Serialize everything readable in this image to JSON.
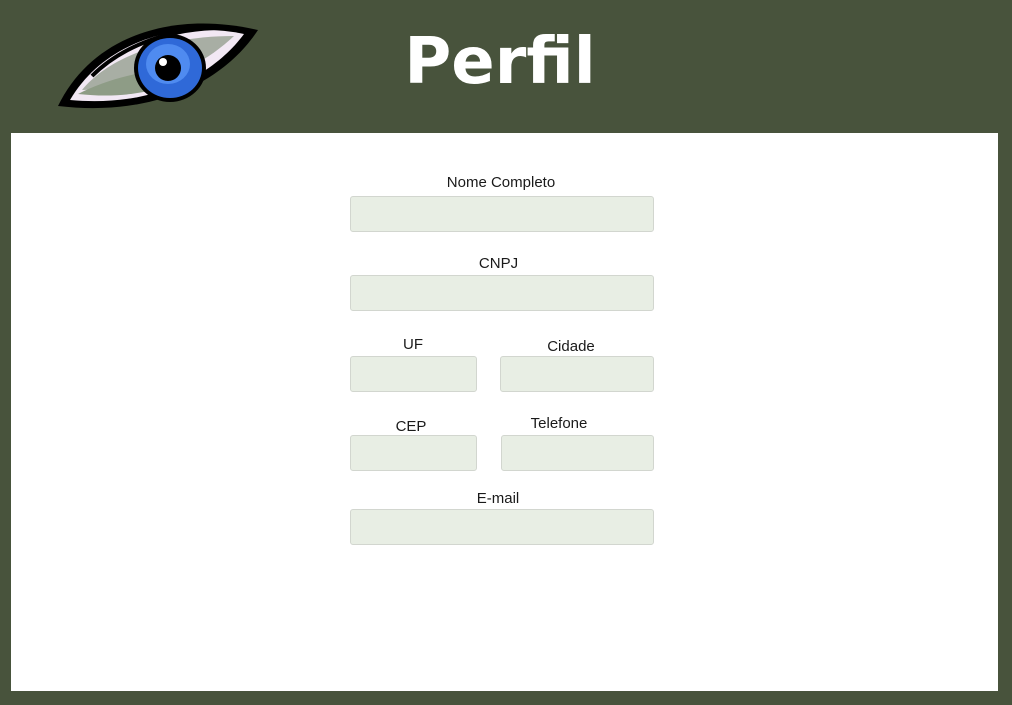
{
  "header": {
    "title": "Perfil",
    "logo_icon": "eye-icon"
  },
  "form": {
    "nome_completo": {
      "label": "Nome Completo",
      "value": ""
    },
    "cnpj": {
      "label": "CNPJ",
      "value": ""
    },
    "uf": {
      "label": "UF",
      "value": ""
    },
    "cidade": {
      "label": "Cidade",
      "value": ""
    },
    "cep": {
      "label": "CEP",
      "value": ""
    },
    "telefone": {
      "label": "Telefone",
      "value": ""
    },
    "email": {
      "label": "E-mail",
      "value": ""
    }
  },
  "colors": {
    "background": "#48533c",
    "panel": "#ffffff",
    "input_fill": "#e8eee4",
    "title_text": "#ffffff"
  }
}
